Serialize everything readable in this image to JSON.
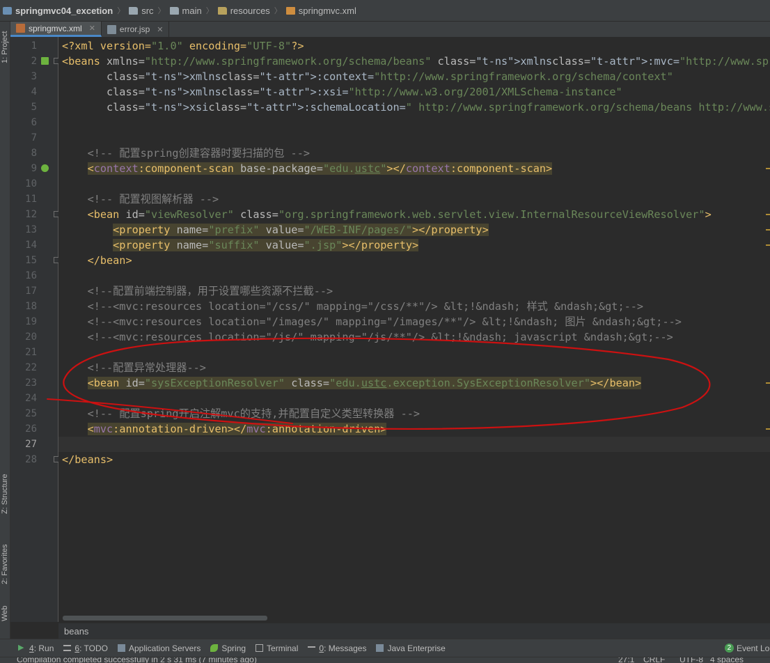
{
  "navbar": {
    "project": "springmvc04_excetion",
    "crumbs": [
      "src",
      "main",
      "resources",
      "springmvc.xml"
    ]
  },
  "left_tools": {
    "project": "1: Project",
    "structure": "Z: Structure",
    "favorites": "2: Favorites",
    "web": "Web"
  },
  "tabs": [
    {
      "label": "springmvc.xml",
      "active": true,
      "icon": "xml-file-icon"
    },
    {
      "label": "error.jsp",
      "active": false,
      "icon": "jsp-file-icon"
    }
  ],
  "editor": {
    "current_line": 27,
    "lines": [
      "<?xml version=\"1.0\" encoding=\"UTF-8\"?>",
      "<beans xmlns=\"http://www.springframework.org/schema/beans\" xmlns:mvc=\"http://www.springframework.org/s",
      "       xmlns:context=\"http://www.springframework.org/schema/context\"",
      "       xmlns:xsi=\"http://www.w3.org/2001/XMLSchema-instance\"",
      "       xsi:schemaLocation=\" http://www.springframework.org/schema/beans http://www.springframework.org",
      "",
      "",
      "    <!-- 配置spring创建容器时要扫描的包 -->",
      "    <context:component-scan base-package=\"edu.ustc\"></context:component-scan>",
      "",
      "    <!-- 配置视图解析器 -->",
      "    <bean id=\"viewResolver\" class=\"org.springframework.web.servlet.view.InternalResourceViewResolver\">",
      "        <property name=\"prefix\" value=\"/WEB-INF/pages/\"></property>",
      "        <property name=\"suffix\" value=\".jsp\"></property>",
      "    </bean>",
      "",
      "    <!--配置前端控制器，用于设置哪些资源不拦截-->",
      "    <!--<mvc:resources location=\"/css/\" mapping=\"/css/**\"/> &lt;!&ndash; 样式 &ndash;&gt;-->",
      "    <!--<mvc:resources location=\"/images/\" mapping=\"/images/**\"/> &lt;!&ndash; 图片 &ndash;&gt;-->",
      "    <!--<mvc:resources location=\"/js/\" mapping=\"/js/**\"/> &lt;!&ndash; javascript &ndash;&gt;-->",
      "",
      "    <!--配置异常处理器-->",
      "    <bean id=\"sysExceptionResolver\" class=\"edu.ustc.exception.SysExceptionResolver\"></bean>",
      "",
      "    <!-- 配置spring开启注解mvc的支持,并配置自定义类型转换器 -->",
      "    <mvc:annotation-driven></mvc:annotation-driven>",
      "",
      "</beans>"
    ]
  },
  "editor_breadcrumb": "beans",
  "toolbar": {
    "run": {
      "key": "4",
      "rest": ": Run"
    },
    "todo": {
      "key": "6",
      "rest": ": TODO"
    },
    "app_servers": "Application Servers",
    "spring": "Spring",
    "terminal": "Terminal",
    "messages": {
      "key": "0",
      "rest": ": Messages"
    },
    "java_ee": "Java Enterprise",
    "event_log": "Event Log",
    "event_count": "2"
  },
  "status": {
    "message": "Compilation completed successfully in 2 s 31 ms (7 minutes ago)",
    "position": "27:1",
    "line_sep": "CRLF",
    "encoding": "UTF-8",
    "indent": "4 spaces"
  },
  "colors": {
    "annotation": "#cc1111",
    "accent": "#4a88c7"
  }
}
